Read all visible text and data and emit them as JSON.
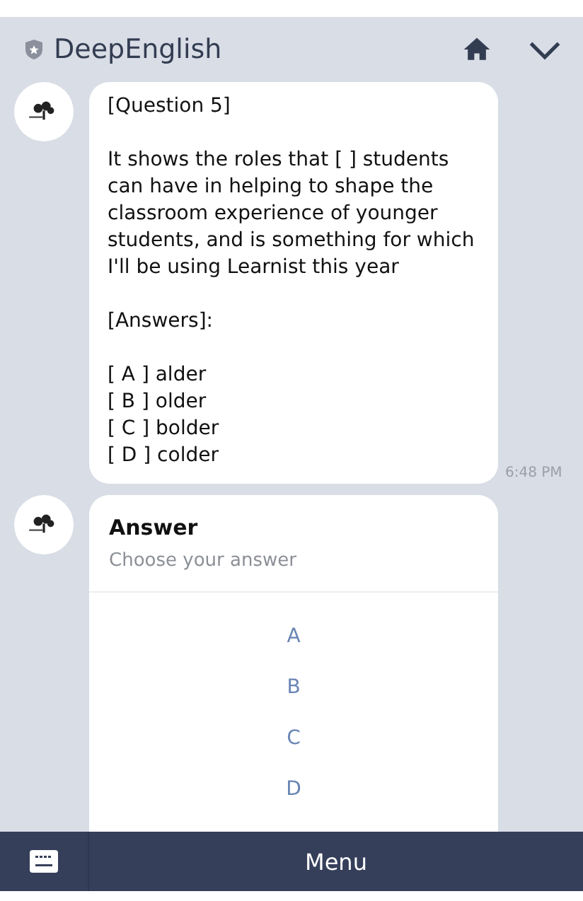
{
  "header": {
    "title": "DeepEnglish"
  },
  "messages": [
    {
      "kind": "text",
      "paragraphs": [
        [
          "[Question 5]"
        ],
        [
          "It shows the roles that [ ] students can have in helping to shape the classroom experience of younger students, and is something for which I'll be using Learnist this year"
        ],
        [
          "[Answers]:"
        ],
        [
          "[ A ] alder",
          "[ B ] older",
          "[ C ] bolder",
          "[ D ] colder"
        ]
      ],
      "time": "6:48 PM"
    },
    {
      "kind": "choices",
      "title": "Answer",
      "subtitle": "Choose your answer",
      "options": [
        "A",
        "B",
        "C",
        "D"
      ]
    }
  ],
  "bottom_bar": {
    "menu_label": "Menu"
  }
}
